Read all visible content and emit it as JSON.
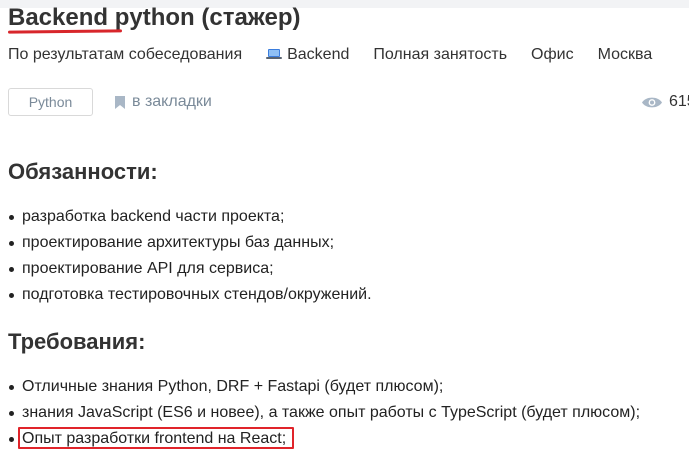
{
  "vacancy": {
    "title": "Backend python (стажер)",
    "meta": {
      "salary": "По результатам собеседования",
      "category": "Backend",
      "employment": "Полная занятость",
      "workplace": "Офис",
      "city": "Москва"
    },
    "tag": "Python",
    "bookmark_label": "в закладки",
    "views": "615"
  },
  "sections": {
    "duties": {
      "heading": "Обязанности:",
      "items": [
        "разработка backend части проекта;",
        "проектирование архитектуры баз данных;",
        "проектирование API для сервиса;",
        "подготовка тестировочных стендов/окружений."
      ]
    },
    "requirements": {
      "heading": "Требования:",
      "items": [
        "Отличные знания Python, DRF + Fastapi (будет плюсом);",
        "знания JavaScript (ES6 и новее), а также опыт работы с TypeScript (будет плюсом);",
        "Опыт разработки frontend на React;"
      ]
    }
  },
  "colors": {
    "annotation_red": "#d8262b",
    "muted_text": "#7a8a99",
    "laptop_blue": "#3b7ddd"
  },
  "icons": [
    "laptop-icon",
    "bookmark-icon",
    "eye-icon"
  ]
}
